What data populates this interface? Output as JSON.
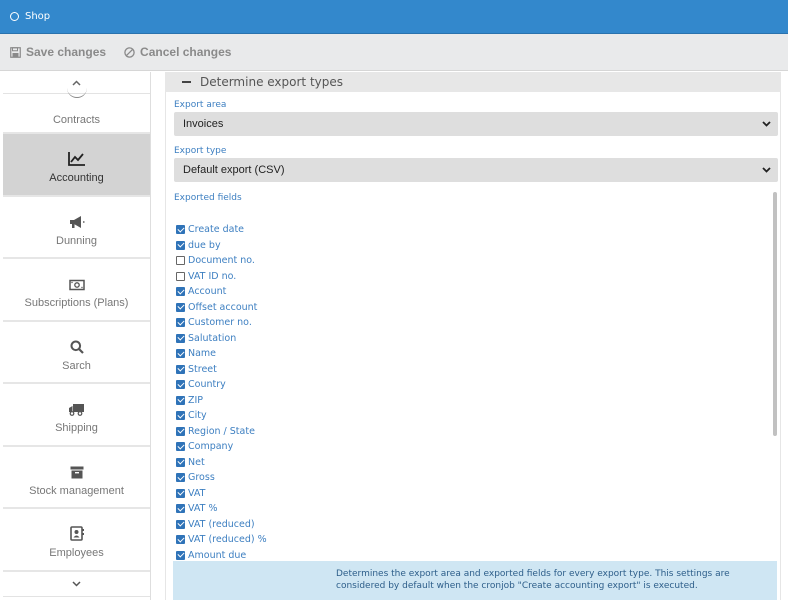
{
  "app": {
    "title": "Shop"
  },
  "toolbar": {
    "save_label": "Save changes",
    "cancel_label": "Cancel changes"
  },
  "sidebar": {
    "items": [
      {
        "label": "Contracts",
        "icon": "contracts-icon"
      },
      {
        "label": "Accounting",
        "icon": "line-chart-icon",
        "active": true
      },
      {
        "label": "Dunning",
        "icon": "megaphone-icon"
      },
      {
        "label": "Subscriptions (Plans)",
        "icon": "money-bill-icon"
      },
      {
        "label": "Sarch",
        "icon": "search-icon"
      },
      {
        "label": "Shipping",
        "icon": "truck-icon"
      },
      {
        "label": "Stock management",
        "icon": "archive-icon"
      },
      {
        "label": "Employees",
        "icon": "address-book-icon"
      }
    ]
  },
  "section": {
    "title": "Determine export types"
  },
  "export_area": {
    "label": "Export area",
    "value": "Invoices"
  },
  "export_type": {
    "label": "Export type",
    "value": "Default export (CSV)"
  },
  "exported_fields": {
    "label": "Exported fields",
    "items": [
      {
        "label": "Create date",
        "checked": true
      },
      {
        "label": "due by",
        "checked": true
      },
      {
        "label": "Document no.",
        "checked": false
      },
      {
        "label": "VAT ID no.",
        "checked": false
      },
      {
        "label": "Account",
        "checked": true
      },
      {
        "label": "Offset account",
        "checked": true
      },
      {
        "label": "Customer no.",
        "checked": true
      },
      {
        "label": "Salutation",
        "checked": true
      },
      {
        "label": "Name",
        "checked": true
      },
      {
        "label": "Street",
        "checked": true
      },
      {
        "label": "Country",
        "checked": true
      },
      {
        "label": "ZIP",
        "checked": true
      },
      {
        "label": "City",
        "checked": true
      },
      {
        "label": "Region / State",
        "checked": true
      },
      {
        "label": "Company",
        "checked": true
      },
      {
        "label": "Net",
        "checked": true
      },
      {
        "label": "Gross",
        "checked": true
      },
      {
        "label": "VAT",
        "checked": true
      },
      {
        "label": "VAT %",
        "checked": true
      },
      {
        "label": "VAT (reduced)",
        "checked": true
      },
      {
        "label": "VAT (reduced) %",
        "checked": true
      },
      {
        "label": "Amount due",
        "checked": true
      }
    ]
  },
  "info": {
    "text": "Determines the export area and exported fields for every export type. This settings are considered by default when the cronjob \"Create accounting export\" is executed."
  },
  "colors": {
    "accent": "#3388cc",
    "label_blue": "#3d7fc1",
    "info_bg": "#cfe6f3",
    "active_bg": "#d3d3d3"
  }
}
